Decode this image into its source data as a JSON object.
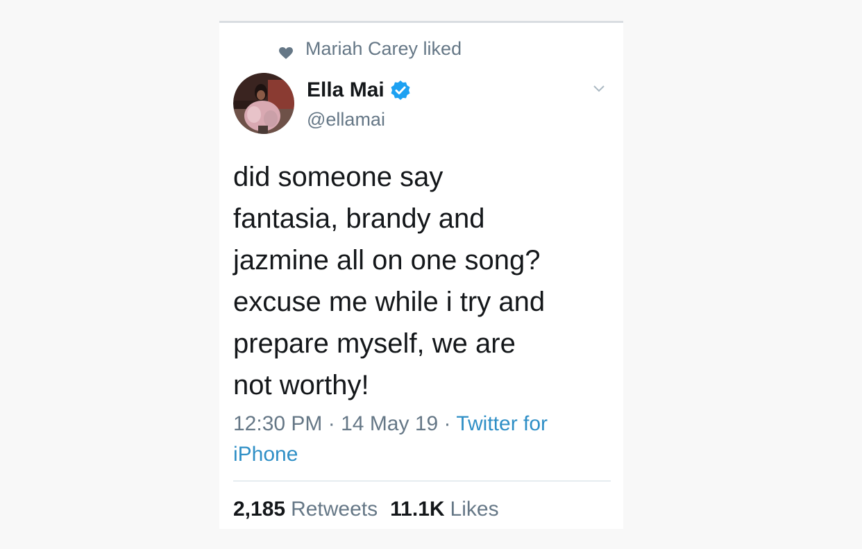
{
  "social_context": {
    "text": "Mariah Carey liked",
    "icon": "heart-icon"
  },
  "author": {
    "name": "Ella Mai",
    "handle": "@ellamai",
    "verified": true
  },
  "tweet": {
    "lines": [
      "did someone say",
      "fantasia, brandy and",
      "jazmine all on one song?",
      "excuse me while i try and",
      "prepare myself, we are",
      "not worthy!"
    ]
  },
  "meta": {
    "time": "12:30 PM",
    "separator": "·",
    "date": "14 May 19",
    "source_line1": "Twitter for",
    "source_line2": "iPhone"
  },
  "stats": {
    "retweets_count": "2,185",
    "retweets_label": "Retweets",
    "likes_count": "11.1K",
    "likes_label": "Likes"
  },
  "colors": {
    "text_primary": "#14171a",
    "text_secondary": "#657786",
    "link": "#2f8fc6",
    "verified": "#1da1f2"
  }
}
